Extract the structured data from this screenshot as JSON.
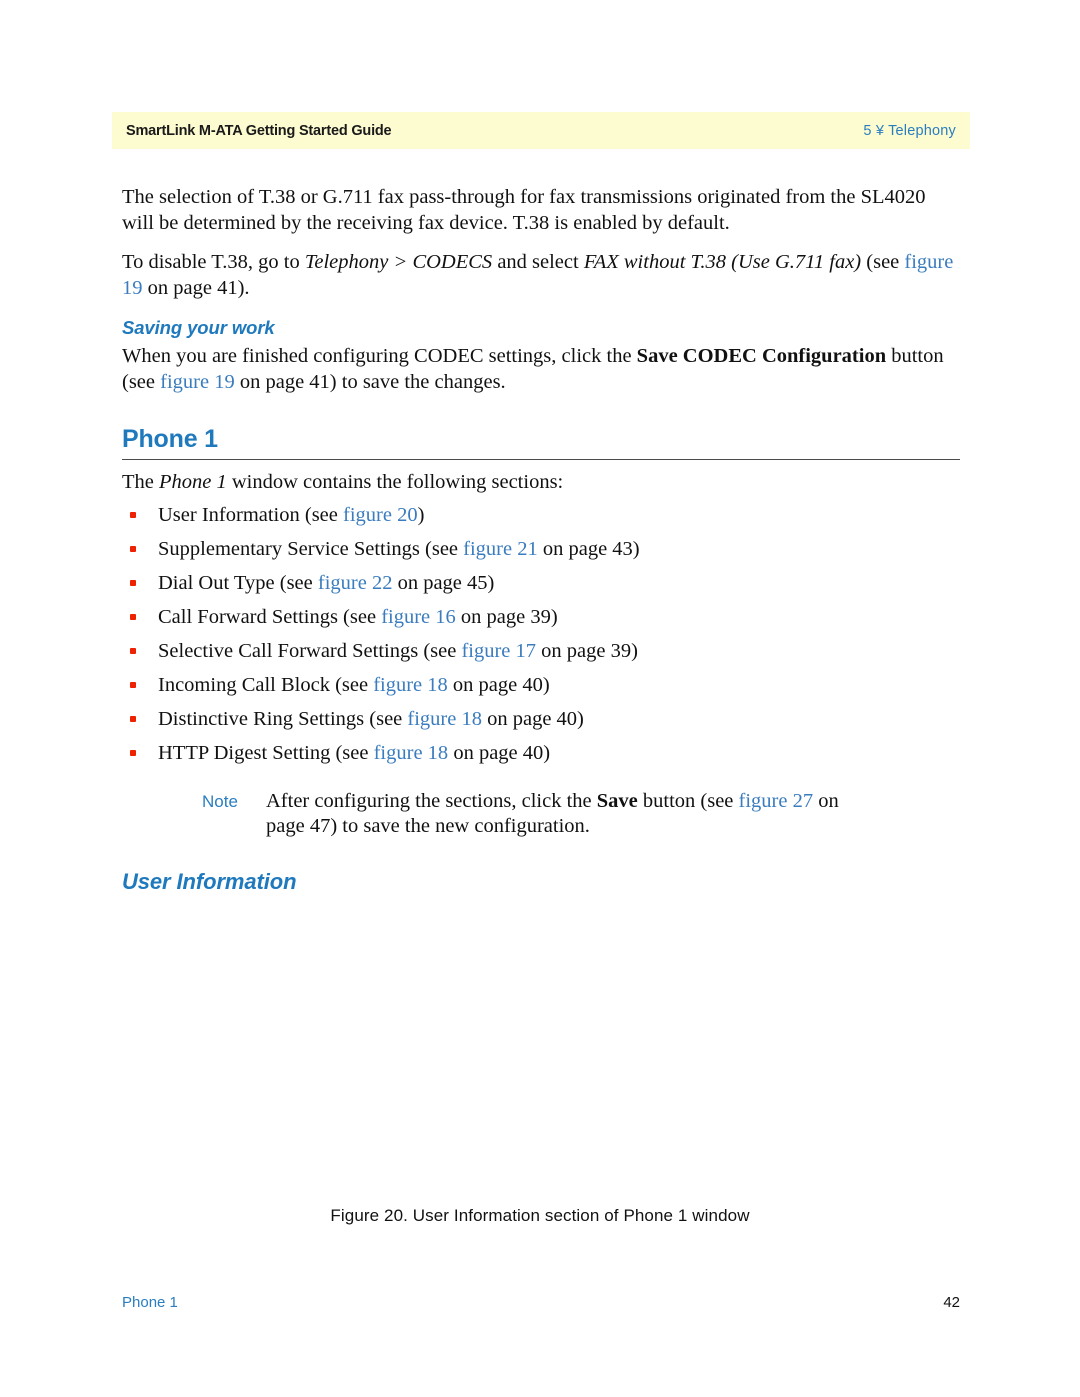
{
  "header": {
    "left_title": "SmartLink M-ATA Getting Started Guide",
    "right_title": "5 ¥ Telephony",
    "band_color": "#fdfbd0",
    "link_color": "#2a7ec0"
  },
  "body": {
    "para1_a": "The selection of T.38 or G.711 fax pass-through for fax transmissions originated from the SL4020 will be determined by the receiving fax device. T.38 is enabled by default.",
    "para2_a": "To disable T.38, go to ",
    "para2_it1": "Telephony > CODECS",
    "para2_b": " and select ",
    "para2_it2": "FAX without T.38 (Use G.711 fax)",
    "para2_c": " (see ",
    "para2_link": "figure 19",
    "para2_d": " on page 41)."
  },
  "saving": {
    "heading": "Saving your work",
    "text_a": "When you are finished configuring CODEC settings, click the ",
    "text_bold": "Save CODEC Configuration",
    "text_b": " button (see ",
    "text_link": "figure 19",
    "text_c": " on page 41) to save the changes."
  },
  "phone_section": {
    "heading": "Phone 1",
    "intro_a": "The ",
    "intro_it": "Phone 1",
    "intro_b": " window contains the following sections:",
    "bullets": [
      {
        "text_a": "User Information (see ",
        "link": "figure 20",
        "text_b": ")"
      },
      {
        "text_a": "Supplementary Service Settings (see ",
        "link": "figure 21",
        "text_b": " on page 43)"
      },
      {
        "text_a": "Dial Out Type (see ",
        "link": "figure 22",
        "text_b": " on page 45)"
      },
      {
        "text_a": "Call Forward Settings (see ",
        "link": "figure 16",
        "text_b": " on page 39)"
      },
      {
        "text_a": "Selective Call Forward Settings (see ",
        "link": "figure 17",
        "text_b": " on page 39)"
      },
      {
        "text_a": "Incoming Call Block (see ",
        "link": "figure 18",
        "text_b": " on page 40)"
      },
      {
        "text_a": "Distinctive Ring Settings (see ",
        "link": "figure 18",
        "text_b": " on page 40)"
      },
      {
        "text_a": "HTTP Digest Setting (see ",
        "link": "figure 18",
        "text_b": " on page 40)"
      }
    ],
    "bullet_color": "#ee2200"
  },
  "note": {
    "label": "Note",
    "text_a": "After configuring the sections, click the ",
    "text_bold": "Save",
    "text_b": " button (see ",
    "text_link": "figure 27",
    "text_c": " on page 47) to save the new configuration."
  },
  "user_information": {
    "heading": "User Information"
  },
  "figure": {
    "caption": "Figure 20. User Information section of Phone 1 window"
  },
  "footer": {
    "left": "Phone 1",
    "right": "42"
  }
}
